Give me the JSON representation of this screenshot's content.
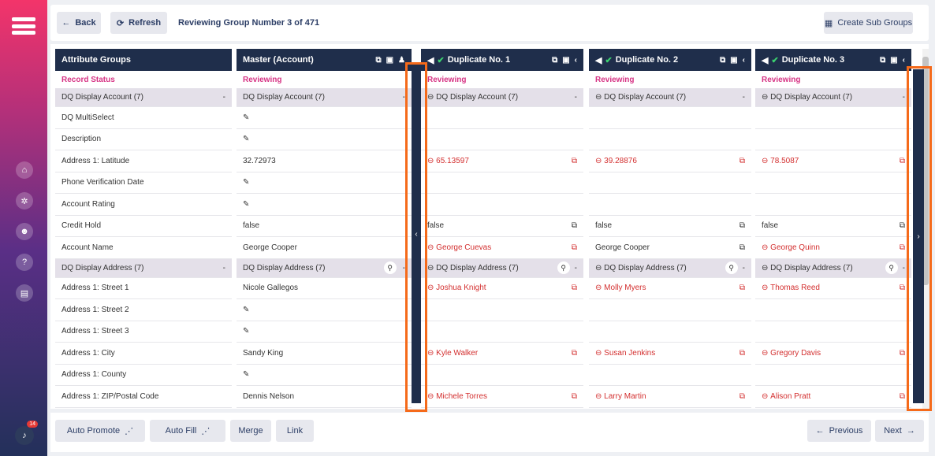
{
  "nav": {
    "icons": [
      "home-icon",
      "gear-icon",
      "user-settings-icon",
      "help-icon",
      "chat-icon"
    ],
    "notif_count": "14"
  },
  "top": {
    "back": "Back",
    "refresh": "Refresh",
    "crumb": "Reviewing Group Number 3 of 471",
    "create": "Create Sub Groups"
  },
  "attr": {
    "title": "Attribute Groups",
    "status": "Record Status",
    "g1": "DQ Display Account (7)",
    "r": [
      "DQ MultiSelect",
      "Description",
      "Address 1: Latitude",
      "Phone Verification Date",
      "Account Rating",
      "Credit Hold",
      "Account Name"
    ],
    "g2": "DQ Display Address (7)",
    "r2": [
      "Address 1: Street 1",
      "Address 1: Street 2",
      "Address 1: Street 3",
      "Address 1: City",
      "Address 1: County",
      "Address 1: ZIP/Postal Code"
    ]
  },
  "master": {
    "title": "Master (Account)",
    "status": "Reviewing",
    "g1": "DQ Display Account (7)",
    "r": [
      "",
      "",
      "32.72973",
      "",
      "",
      "false",
      "George Cooper"
    ],
    "g2": "DQ Display Address (7)",
    "r2": [
      "Nicole Gallegos",
      "",
      "",
      "Sandy King",
      "",
      "Dennis Nelson"
    ]
  },
  "dups": [
    {
      "title": "Duplicate No. 1",
      "status": "Reviewing",
      "g1": "DQ Display Account (7)",
      "lat": "65.13597",
      "credit": "false",
      "name": "George Cuevas",
      "g2": "DQ Display Address (7)",
      "s1": "Joshua Knight",
      "city": "Kyle Walker",
      "zip": "Michele Torres"
    },
    {
      "title": "Duplicate No. 2",
      "status": "Reviewing",
      "g1": "DQ Display Account (7)",
      "lat": "39.28876",
      "credit": "false",
      "name": "George Cooper",
      "g2": "DQ Display Address (7)",
      "s1": "Molly Myers",
      "city": "Susan Jenkins",
      "zip": "Larry Martin"
    },
    {
      "title": "Duplicate No. 3",
      "status": "Reviewing",
      "g1": "DQ Display Account (7)",
      "lat": "78.5087",
      "credit": "false",
      "name": "George Quinn",
      "g2": "DQ Display Address (7)",
      "s1": "Thomas Reed",
      "city": "Gregory Davis",
      "zip": "Alison Pratt"
    }
  ],
  "bottom": {
    "promote": "Auto Promote",
    "fill": "Auto Fill",
    "merge": "Merge",
    "link": "Link",
    "prev": "Previous",
    "next": "Next"
  }
}
